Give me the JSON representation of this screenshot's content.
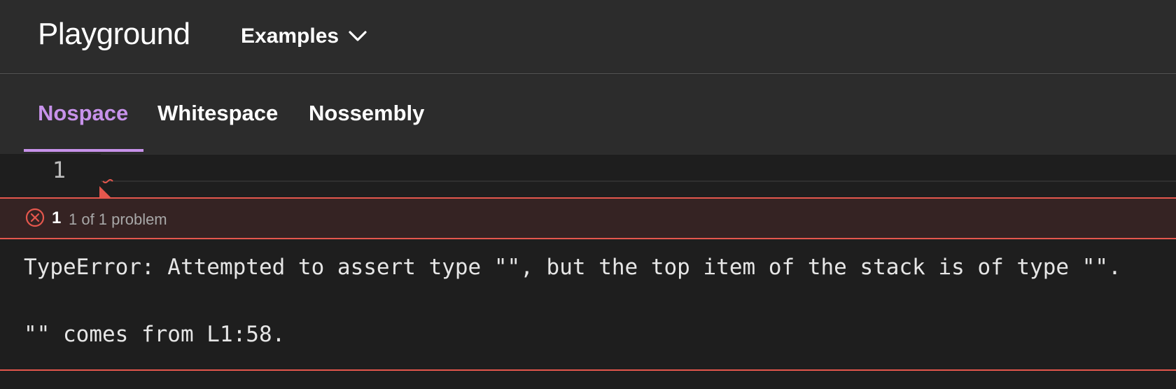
{
  "header": {
    "app_title": "Playground",
    "examples_label": "Examples"
  },
  "tabs": [
    {
      "label": "Nospace",
      "active": true
    },
    {
      "label": "Whitespace",
      "active": false
    },
    {
      "label": "Nossembly",
      "active": false
    }
  ],
  "editor": {
    "line_numbers": [
      "1"
    ]
  },
  "problems": {
    "count": "1",
    "summary": "1 of 1 problem",
    "messages": [
      "TypeError: Attempted to assert type \"\", but the top item of the stack is of type \"\".",
      "\"\" comes from L1:58."
    ]
  },
  "colors": {
    "accent": "#c792ea",
    "error": "#e5574d",
    "header_bg": "#2c2c2c",
    "editor_bg": "#1e1e1e",
    "problem_bg": "#352323"
  },
  "icons": {
    "examples": "chevron-down-icon",
    "problem": "error-circle-x-icon"
  }
}
